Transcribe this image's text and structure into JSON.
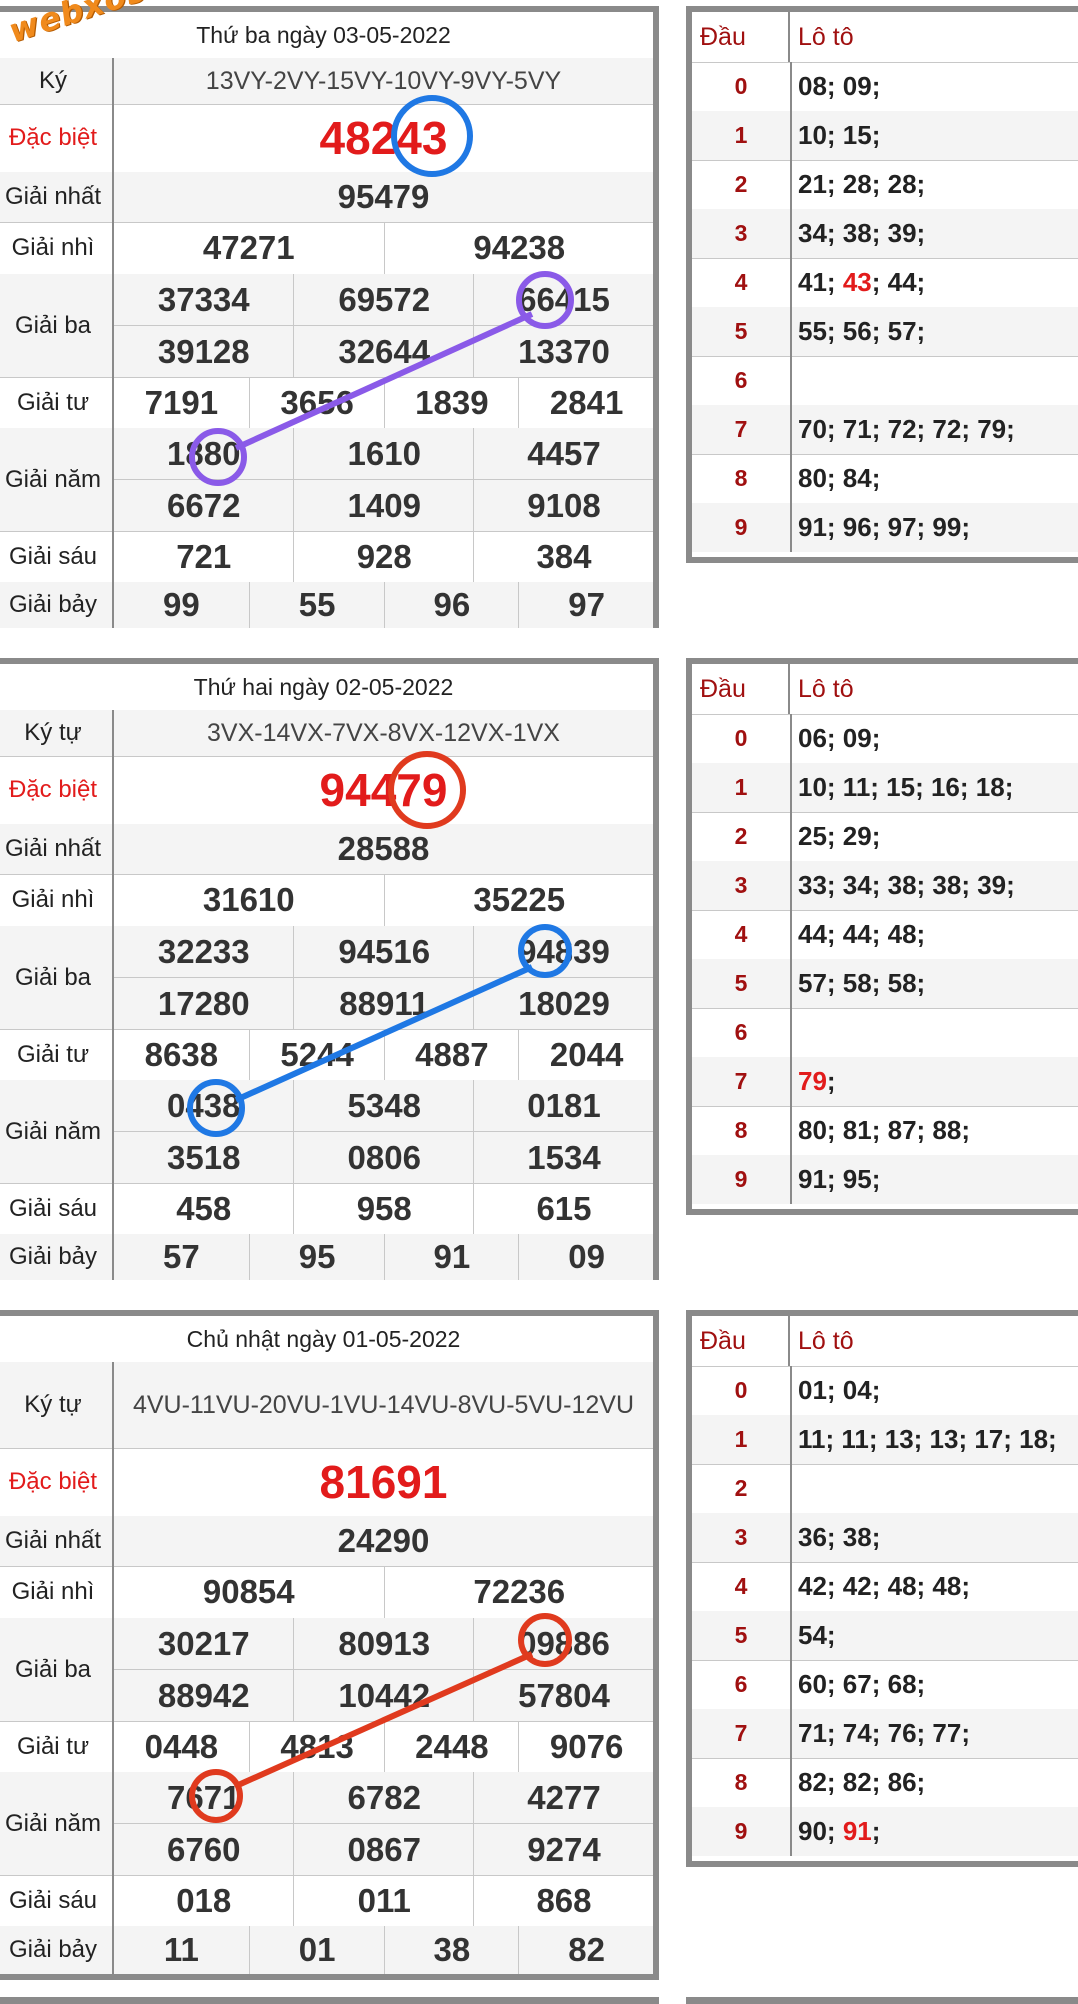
{
  "colors": {
    "blue": "#1f78e4",
    "purple": "#8a5ae8",
    "red": "#e03a1e",
    "special": "#e21b1b"
  },
  "labels": {
    "dau": "Đầu",
    "loto": "Lô tô",
    "kytu": "Ký tự",
    "dacbiet": "Đặc biệt",
    "giai1": "Giải nhất",
    "giai2": "Giải nhì",
    "giai3": "Giải ba",
    "giai4": "Giải tư",
    "giai5": "Giải năm",
    "giai6": "Giải sáu",
    "giai7": "Giải bảy"
  },
  "watermark": "webxoso.net",
  "draws": [
    {
      "title": "Thứ ba ngày 03-05-2022",
      "kytu_label": "Ký",
      "kytu": "13VY-2VY-15VY-10VY-9VY-5VY",
      "special": "48243",
      "g1": "95479",
      "g2": [
        "47271",
        "94238"
      ],
      "g3": [
        "37334",
        "69572",
        "66415",
        "39128",
        "32644",
        "13370"
      ],
      "g4": [
        "7191",
        "3656",
        "1839",
        "2841"
      ],
      "g5": [
        "1880",
        "1610",
        "4457",
        "6672",
        "1409",
        "9108"
      ],
      "g6": [
        "721",
        "928",
        "384"
      ],
      "g7": [
        "99",
        "55",
        "96",
        "97"
      ],
      "loto": [
        {
          "d": "0",
          "v": "08; 09;"
        },
        {
          "d": "1",
          "v": "10; 15;"
        },
        {
          "d": "2",
          "v": "21; 28; 28;"
        },
        {
          "d": "3",
          "v": "34; 38; 39;"
        },
        {
          "d": "4",
          "pre": "41; ",
          "hl": "43",
          "post": "; 44;"
        },
        {
          "d": "5",
          "v": "55; 56; 57;"
        },
        {
          "d": "6",
          "v": ""
        },
        {
          "d": "7",
          "v": "70; 71; 72; 72; 79;"
        },
        {
          "d": "8",
          "v": "80; 84;"
        },
        {
          "d": "9",
          "v": "91; 96; 97; 99;"
        }
      ]
    },
    {
      "title": "Thứ hai ngày 02-05-2022",
      "kytu_label": "Ký tự",
      "kytu": "3VX-14VX-7VX-8VX-12VX-1VX",
      "special": "94479",
      "g1": "28588",
      "g2": [
        "31610",
        "35225"
      ],
      "g3": [
        "32233",
        "94516",
        "94839",
        "17280",
        "88911",
        "18029"
      ],
      "g4": [
        "8638",
        "5244",
        "4887",
        "2044"
      ],
      "g5": [
        "0438",
        "5348",
        "0181",
        "3518",
        "0806",
        "1534"
      ],
      "g6": [
        "458",
        "958",
        "615"
      ],
      "g7": [
        "57",
        "95",
        "91",
        "09"
      ],
      "loto": [
        {
          "d": "0",
          "v": "06; 09;"
        },
        {
          "d": "1",
          "v": "10; 11; 15; 16; 18;"
        },
        {
          "d": "2",
          "v": "25; 29;"
        },
        {
          "d": "3",
          "v": "33; 34; 38; 38; 39;"
        },
        {
          "d": "4",
          "v": "44; 44; 48;"
        },
        {
          "d": "5",
          "v": "57; 58; 58;"
        },
        {
          "d": "6",
          "v": ""
        },
        {
          "d": "7",
          "pre": "",
          "hl": "79",
          "post": ";"
        },
        {
          "d": "8",
          "v": "80; 81; 87; 88;"
        },
        {
          "d": "9",
          "v": "91; 95;"
        }
      ]
    },
    {
      "title": "Chủ nhật ngày 01-05-2022",
      "kytu_label": "Ký tự",
      "kytu": "4VU-11VU-20VU-1VU-14VU-8VU-5VU-12VU",
      "special": "81691",
      "g1": "24290",
      "g2": [
        "90854",
        "72236"
      ],
      "g3": [
        "30217",
        "80913",
        "09886",
        "88942",
        "10442",
        "57804"
      ],
      "g4": [
        "0448",
        "4813",
        "2448",
        "9076"
      ],
      "g5": [
        "7671",
        "6782",
        "4277",
        "6760",
        "0867",
        "9274"
      ],
      "g6": [
        "018",
        "011",
        "868"
      ],
      "g7": [
        "11",
        "01",
        "38",
        "82"
      ],
      "loto": [
        {
          "d": "0",
          "v": "01; 04;"
        },
        {
          "d": "1",
          "v": "11; 11; 13; 13; 17; 18;"
        },
        {
          "d": "2",
          "v": ""
        },
        {
          "d": "3",
          "v": "36; 38;"
        },
        {
          "d": "4",
          "v": "42; 42; 48; 48;"
        },
        {
          "d": "5",
          "v": "54;"
        },
        {
          "d": "6",
          "v": "60; 67; 68;"
        },
        {
          "d": "7",
          "v": "71; 74; 76; 77;"
        },
        {
          "d": "8",
          "v": "82; 82; 86;"
        },
        {
          "d": "9",
          "pre": "90; ",
          "hl": "91",
          "post": ";"
        }
      ]
    }
  ]
}
